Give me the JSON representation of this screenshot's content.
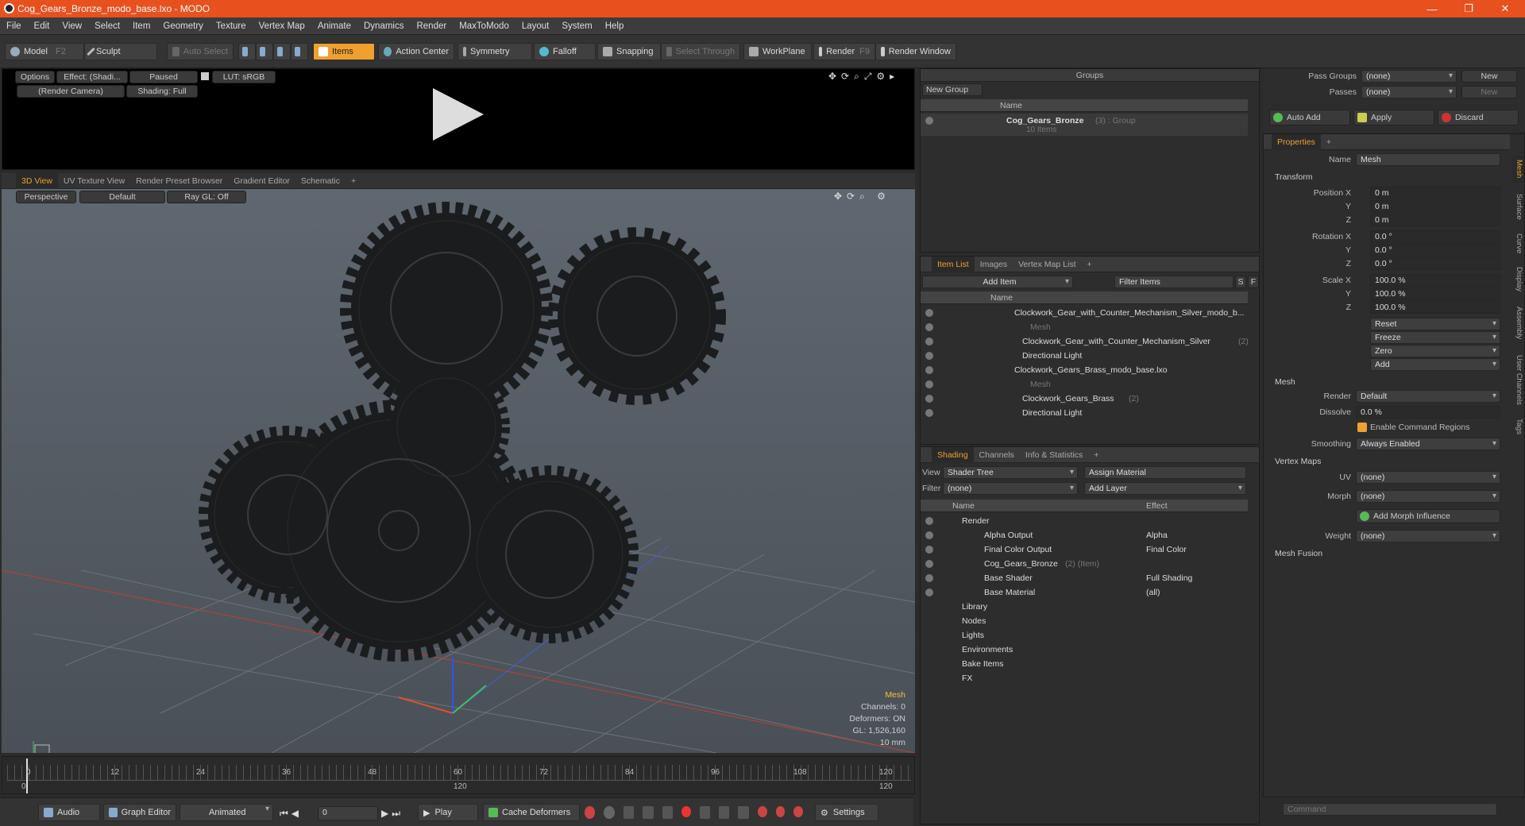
{
  "window": {
    "title": "Cog_Gears_Bronze_modo_base.lxo - MODO",
    "min": "—",
    "max": "❐",
    "close": "✕"
  },
  "menu": [
    "File",
    "Edit",
    "View",
    "Select",
    "Item",
    "Geometry",
    "Texture",
    "Vertex Map",
    "Animate",
    "Dynamics",
    "Render",
    "MaxToModo",
    "Layout",
    "System",
    "Help"
  ],
  "toolbar": {
    "model": "Model",
    "model_key": "F2",
    "sculpt": "Sculpt",
    "auto_select": "Auto Select",
    "items": "Items",
    "action_center": "Action Center",
    "symmetry": "Symmetry",
    "falloff": "Falloff",
    "snapping": "Snapping",
    "select_through": "Select Through",
    "workplane": "WorkPlane",
    "render": "Render",
    "render_key": "F9",
    "render_window": "Render Window"
  },
  "preview": {
    "options": "Options",
    "effect": "Effect: (Shadi...",
    "paused": "Paused",
    "lut": "LUT: sRGB",
    "camera": "(Render Camera)",
    "shading": "Shading: Full",
    "play": "▶"
  },
  "viewtabs": [
    "3D View",
    "UV Texture View",
    "Render Preset Browser",
    "Gradient Editor",
    "Schematic",
    "+"
  ],
  "viewport": {
    "perspective": "Perspective",
    "default": "Default",
    "raygl": "Ray GL: Off",
    "info_title": "Mesh",
    "info_channels": "Channels: 0",
    "info_deformers": "Deformers: ON",
    "info_gl": "GL: 1,526,160",
    "info_scale": "10 mm"
  },
  "timeline": {
    "ticks": [
      "0",
      "12",
      "24",
      "36",
      "48",
      "60",
      "72",
      "84",
      "96",
      "108",
      "120"
    ],
    "sub_ticks": [
      "0",
      "120",
      "120"
    ]
  },
  "bottom": {
    "audio": "Audio",
    "graph_editor": "Graph Editor",
    "animated": "Animated",
    "frame": "0",
    "play": "Play",
    "cache_deformers": "Cache Deformers",
    "settings": "Settings"
  },
  "groups": {
    "title": "Groups",
    "new_group": "New Group",
    "col_name": "Name",
    "item_name": "Cog_Gears_Bronze",
    "item_meta": "(3) : Group",
    "item_sub": "10 Items"
  },
  "itemlist": {
    "tabs": [
      "Item List",
      "Images",
      "Vertex Map List",
      "+"
    ],
    "add_item": "Add Item",
    "filter": "Filter Items",
    "s": "S",
    "f": "F",
    "col_name": "Name",
    "rows": [
      {
        "text": "Clockwork_Gear_with_Counter_Mechanism_Silver_modo_b...",
        "extra": "",
        "indent": 0,
        "dim": false
      },
      {
        "text": "Mesh",
        "extra": "",
        "indent": 2,
        "dim": true
      },
      {
        "text": "Clockwork_Gear_with_Counter_Mechanism_Silver",
        "extra": "(2)",
        "indent": 1,
        "dim": false
      },
      {
        "text": "Directional Light",
        "extra": "",
        "indent": 1,
        "dim": false
      },
      {
        "text": "Clockwork_Gears_Brass_modo_base.lxo",
        "extra": "",
        "indent": 0,
        "dim": false
      },
      {
        "text": "Mesh",
        "extra": "",
        "indent": 2,
        "dim": true
      },
      {
        "text": "Clockwork_Gears_Brass",
        "extra": "(2)",
        "indent": 1,
        "dim": false
      },
      {
        "text": "Directional Light",
        "extra": "",
        "indent": 1,
        "dim": false
      }
    ]
  },
  "shading": {
    "tabs": [
      "Shading",
      "Channels",
      "Info & Statistics",
      "+"
    ],
    "view_label": "View",
    "view_value": "Shader Tree",
    "assign_material": "Assign Material",
    "filter_label": "Filter",
    "filter_value": "(none)",
    "add_layer": "Add Layer",
    "col_name": "Name",
    "col_effect": "Effect",
    "rows": [
      {
        "name": "Render",
        "extra": "",
        "effect": "",
        "indent": 0
      },
      {
        "name": "Alpha Output",
        "extra": "",
        "effect": "Alpha",
        "indent": 1
      },
      {
        "name": "Final Color Output",
        "extra": "",
        "effect": "Final Color",
        "indent": 1
      },
      {
        "name": "Cog_Gears_Bronze",
        "extra": "(2) (Item)",
        "effect": "",
        "indent": 1
      },
      {
        "name": "Base Shader",
        "extra": "",
        "effect": "Full Shading",
        "indent": 1
      },
      {
        "name": "Base Material",
        "extra": "",
        "effect": "(all)",
        "indent": 1
      },
      {
        "name": "Library",
        "extra": "",
        "effect": "",
        "indent": 0
      },
      {
        "name": "Nodes",
        "extra": "",
        "effect": "",
        "indent": 0
      },
      {
        "name": "Lights",
        "extra": "",
        "effect": "",
        "indent": 0
      },
      {
        "name": "Environments",
        "extra": "",
        "effect": "",
        "indent": 0
      },
      {
        "name": "Bake Items",
        "extra": "",
        "effect": "",
        "indent": 0
      },
      {
        "name": "FX",
        "extra": "",
        "effect": "",
        "indent": 0
      }
    ]
  },
  "passes": {
    "pass_groups": "Pass Groups",
    "passes": "Passes",
    "none": "(none)",
    "new": "New",
    "auto_add": "Auto Add",
    "apply": "Apply",
    "discard": "Discard"
  },
  "properties": {
    "tab": "Properties",
    "name_label": "Name",
    "name_value": "Mesh",
    "transform": "Transform",
    "pos_x_label": "Position X",
    "rot_x_label": "Rotation X",
    "scale_x_label": "Scale X",
    "y": "Y",
    "z": "Z",
    "pos": [
      "0 m",
      "0 m",
      "0 m"
    ],
    "rot": [
      "0.0 °",
      "0.0 °",
      "0.0 °"
    ],
    "scale": [
      "100.0 %",
      "100.0 %",
      "100.0 %"
    ],
    "reset": "Reset",
    "freeze": "Freeze",
    "zero": "Zero",
    "add": "Add",
    "mesh": "Mesh",
    "render_label": "Render",
    "render_value": "Default",
    "dissolve_label": "Dissolve",
    "dissolve_value": "0.0 %",
    "enable_cmd": "Enable Command Regions",
    "smoothing_label": "Smoothing",
    "smoothing_value": "Always Enabled",
    "vertex_maps": "Vertex Maps",
    "uv_label": "UV",
    "uv_value": "(none)",
    "morph_label": "Morph",
    "morph_value": "(none)",
    "add_morph": "Add Morph Influence",
    "weight_label": "Weight",
    "weight_value": "(none)",
    "mesh_fusion": "Mesh Fusion",
    "vtabs": [
      "Mesh",
      "Surface",
      "Curve",
      "Display",
      "Assembly",
      "User Channels",
      "Tags"
    ],
    "command_placeholder": "Command"
  }
}
